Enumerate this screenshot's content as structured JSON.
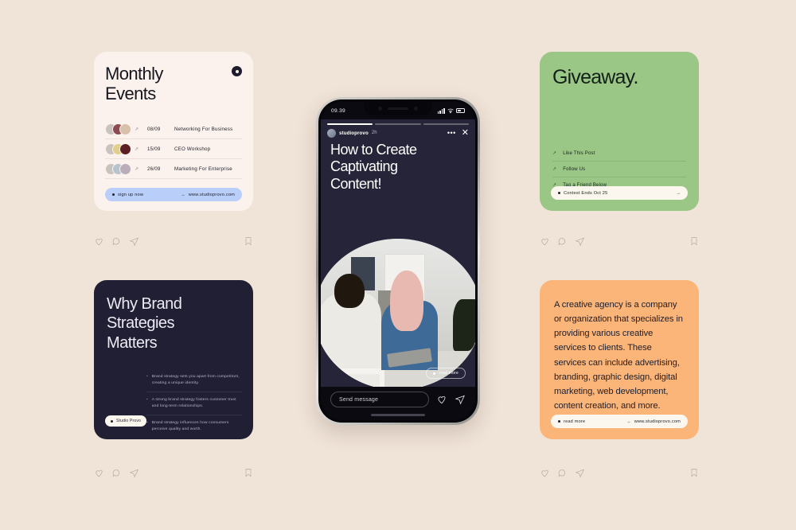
{
  "page": {
    "background_color": "#f0e3d7"
  },
  "cards": {
    "events": {
      "background_color": "#fbf2ed",
      "title_line1": "Monthly",
      "title_line2": "Events",
      "menu_icon": "dot-badge-icon",
      "rows": [
        {
          "arrow": "↗",
          "date": "08/09",
          "name": "Networking For Business",
          "avatars": [
            "#c9c3bd",
            "#8e4a52",
            "#d8c0ab"
          ]
        },
        {
          "arrow": "↗",
          "date": "15/09",
          "name": "CEO Workshop",
          "avatars": [
            "#c9c3bd",
            "#e3cf8c",
            "#5c1f23"
          ]
        },
        {
          "arrow": "↗",
          "date": "26/09",
          "name": "Marketing For Enterprise",
          "avatars": [
            "#c9c3bd",
            "#b8c4cd",
            "#b9aeb9"
          ]
        }
      ],
      "pill": {
        "background_color": "#b9cffa",
        "left_label": "sign up now",
        "right_label": "www.studioprovo.com",
        "right_arrow": "→"
      }
    },
    "giveaway": {
      "background_color": "#9ac686",
      "title": "Giveaway.",
      "rows": [
        {
          "arrow": "↗",
          "label": "Like This Post"
        },
        {
          "arrow": "↗",
          "label": "Follow Us"
        },
        {
          "arrow": "↗",
          "label": "Tag a Friend Below"
        }
      ],
      "pill": {
        "background_color": "#fbf7ef",
        "left_label": "Contest Ends Oct 25",
        "right_arrow": "→"
      }
    },
    "brand": {
      "background_color": "#211f33",
      "title_line1": "Why Brand",
      "title_line2": "Strategies",
      "title_line3": "Matters",
      "bullets": [
        "Brand strategy sets you apart from competitors, creating a unique identity.",
        "A strong brand strategy fosters customer trust and long-term relationships.",
        "Brand strategy influences how consumers perceive quality and worth."
      ],
      "badge_label": "Studio Provo"
    },
    "agency": {
      "background_color": "#fcb579",
      "body": "A creative agency is a company or organization that specializes in providing various creative services to clients. These services can include advertising, branding, graphic design, digital marketing, web development, content creation, and more.",
      "pill": {
        "background_color": "#fbf7ef",
        "left_label": "read more",
        "right_label": "www.studioprovo.com",
        "right_arrow": "→"
      }
    }
  },
  "post_actions": {
    "like_icon": "heart-icon",
    "comment_icon": "comment-icon",
    "share_icon": "share-icon",
    "save_icon": "bookmark-icon"
  },
  "phone": {
    "status": {
      "time": "09.39",
      "signal_icon": "cellular-signal-icon",
      "wifi_icon": "wifi-icon",
      "battery_icon": "battery-icon"
    },
    "story": {
      "progress_segments": 3,
      "active_segment": 1,
      "username": "studioprovo",
      "timestamp": "2h",
      "more_icon": "•••",
      "close_icon": "✕",
      "title_line1": "How to Create",
      "title_line2": "Captivating",
      "title_line3": "Content!",
      "read_more_label": "read more"
    },
    "footer": {
      "message_placeholder": "Send message",
      "like_icon": "heart-icon",
      "send_icon": "send-icon"
    }
  }
}
